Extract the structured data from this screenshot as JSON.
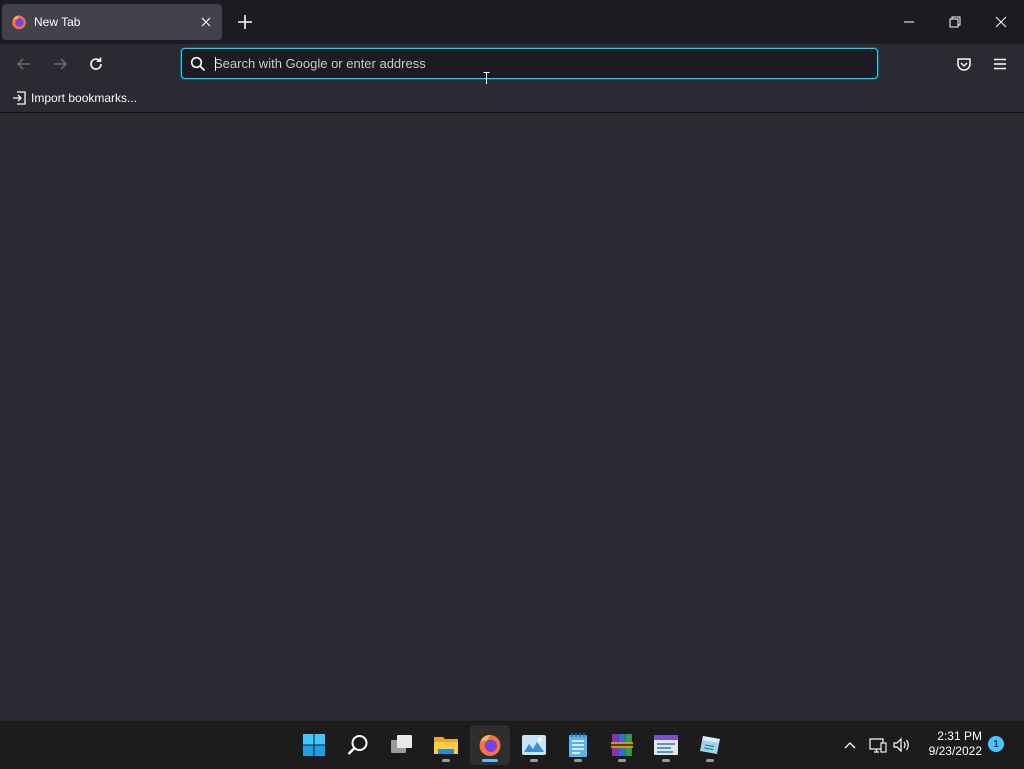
{
  "browser": {
    "tab": {
      "title": "New Tab"
    },
    "urlbar": {
      "placeholder": "Search with Google or enter address",
      "value": ""
    },
    "bookmarks_toolbar": {
      "import_label": "Import bookmarks..."
    }
  },
  "taskbar": {
    "apps": [
      "start-icon",
      "search-icon",
      "task-view-icon",
      "file-explorer-icon",
      "firefox-icon",
      "photos-icon",
      "notepad-icon",
      "winrar-icon",
      "control-panel-icon",
      "app-icon"
    ],
    "clock": {
      "time": "2:31 PM",
      "date": "9/23/2022"
    },
    "notification_count": "1"
  },
  "colors": {
    "accent": "#00ddff",
    "toolbar_bg": "#2b2a33",
    "titlebar_bg": "#1c1b22",
    "tab_bg": "#42414d",
    "taskbar_bg": "#1c1c1c",
    "windows_accent": "#4cc2ff"
  }
}
